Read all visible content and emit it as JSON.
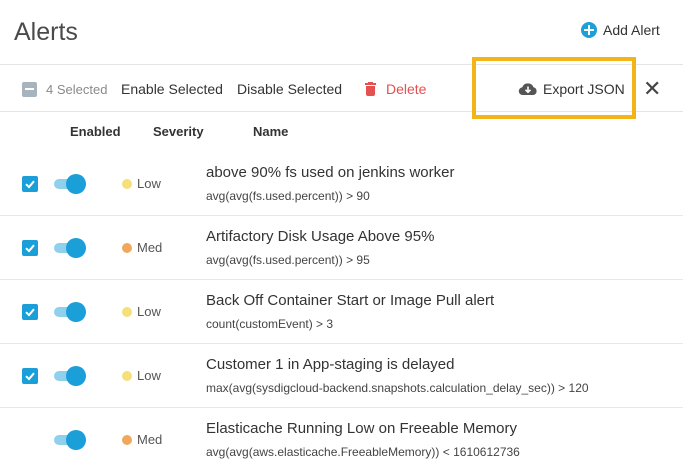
{
  "page": {
    "title": "Alerts",
    "add_alert_label": "Add Alert"
  },
  "toolbar": {
    "selected_label": "4 Selected",
    "enable_selected": "Enable Selected",
    "disable_selected": "Disable Selected",
    "delete": "Delete",
    "export_json": "Export JSON",
    "close": "✕"
  },
  "columns": {
    "enabled": "Enabled",
    "severity": "Severity",
    "name": "Name"
  },
  "colors": {
    "accent": "#1b9fd8",
    "delete": "#e55050",
    "highlight": "#f2b418",
    "low": "#f5e07a",
    "med": "#f0a85c"
  },
  "alerts": [
    {
      "selected": true,
      "enabled": true,
      "severity": "Low",
      "name": "above 90% fs used on jenkins worker",
      "condition": "avg(avg(fs.used.percent)) > 90"
    },
    {
      "selected": true,
      "enabled": true,
      "severity": "Med",
      "name": "Artifactory Disk Usage Above 95%",
      "condition": "avg(avg(fs.used.percent)) > 95"
    },
    {
      "selected": true,
      "enabled": true,
      "severity": "Low",
      "name": "Back Off Container Start or Image Pull alert",
      "condition": "count(customEvent) > 3"
    },
    {
      "selected": true,
      "enabled": true,
      "severity": "Low",
      "name": "Customer 1 in App-staging is delayed",
      "condition": "max(avg(sysdigcloud-backend.snapshots.calculation_delay_sec)) > 120"
    },
    {
      "selected": false,
      "enabled": true,
      "severity": "Med",
      "name": "Elasticache Running Low on Freeable Memory",
      "condition": "avg(avg(aws.elasticache.FreeableMemory)) < 1610612736"
    }
  ]
}
